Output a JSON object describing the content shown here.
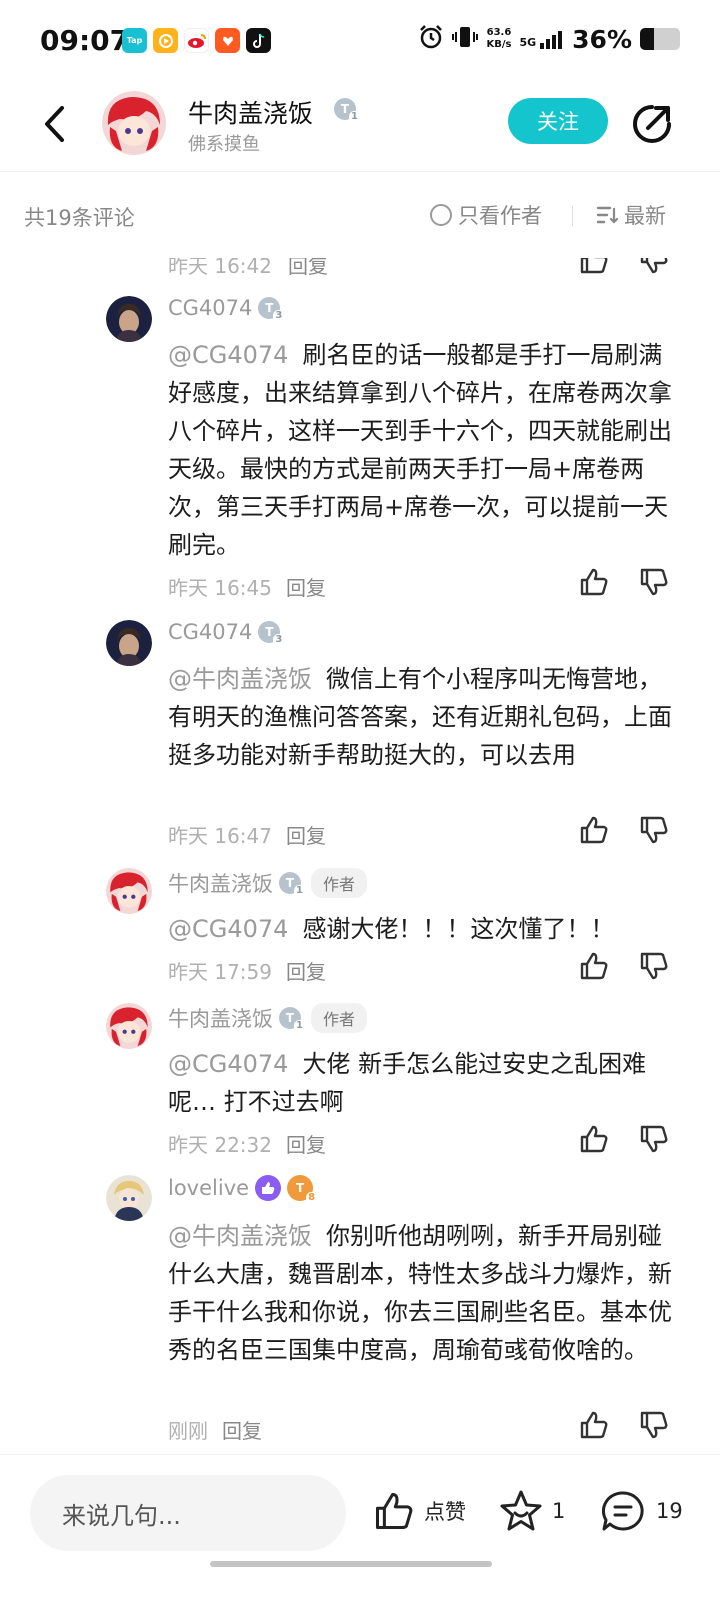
{
  "status_bar": {
    "time": "09:07",
    "net_speed_value": "63.6",
    "net_speed_unit": "KB/s",
    "network": "5G",
    "battery_percent": "36%",
    "battery_level": 0.36,
    "app_icons": [
      "taptap-icon",
      "video-app-icon",
      "weibo-icon",
      "taobao-icon",
      "tiktok-icon"
    ],
    "app_labels": {
      "taptap": "Tap"
    }
  },
  "header": {
    "user_name": "牛肉盖浇饭",
    "user_subtitle": "佛系摸鱼",
    "follow_label": "关注",
    "level": "1"
  },
  "comments_bar": {
    "count_label": "共19条评论",
    "only_author_label": "只看作者",
    "sort_label": "最新"
  },
  "partial_top": {
    "time": "昨天 16:42",
    "reply": "回复"
  },
  "comments": [
    {
      "name": "CG4074",
      "level": "3",
      "mention": "@CG4074",
      "text": "刷名臣的话一般都是手打一局刷满好感度，出来结算拿到八个碎片，在席卷两次拿八个碎片，这样一天到手十六个，四天就能刷出天级。最快的方式是前两天手打一局+席卷两次，第三天手打两局+席卷一次，可以提前一天刷完。",
      "time": "昨天 16:45",
      "reply": "回复"
    },
    {
      "name": "CG4074",
      "level": "3",
      "mention": "@牛肉盖浇饭",
      "text": "微信上有个小程序叫无悔营地，有明天的渔樵问答答案，还有近期礼包码，上面挺多功能对新手帮助挺大的，可以去用",
      "time": "昨天 16:47",
      "reply": "回复"
    },
    {
      "name": "牛肉盖浇饭",
      "level": "1",
      "author_tag": "作者",
      "mention": "@CG4074",
      "text": "感谢大佬！！！这次懂了！！",
      "time": "昨天 17:59",
      "reply": "回复"
    },
    {
      "name": "牛肉盖浇饭",
      "level": "1",
      "author_tag": "作者",
      "mention": "@CG4074",
      "text": "大佬  新手怎么能过安史之乱困难呢… 打不过去啊",
      "time": "昨天 22:32",
      "reply": "回复"
    },
    {
      "name": "lovelive",
      "level": "8",
      "mention": "@牛肉盖浇饭",
      "text": "你别听他胡咧咧，新手开局别碰什么大唐，魏晋剧本，特性太多战斗力爆炸，新手干什么我和你说，你去三国刷些名臣。基本优秀的名臣三国集中度高，周瑜荀彧荀攸啥的。",
      "time": "刚刚",
      "reply": "回复"
    }
  ],
  "bottom_bar": {
    "input_placeholder": "来说几句...",
    "like_label": "点赞",
    "fav_count": "1",
    "comment_count": "19"
  },
  "colors": {
    "accent": "#15c5ce",
    "text_primary": "#1d1d1d",
    "text_secondary": "#9a9a9a"
  }
}
